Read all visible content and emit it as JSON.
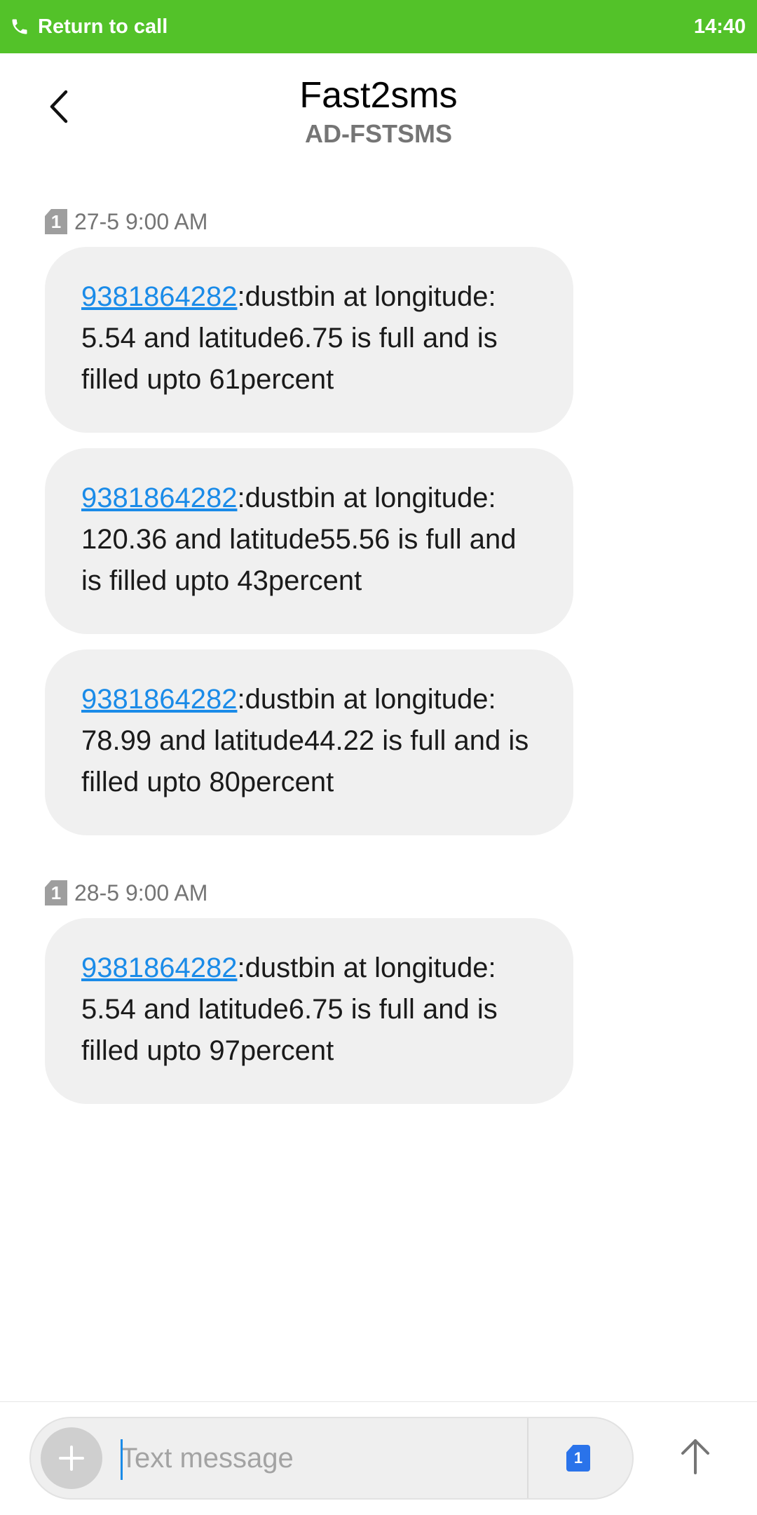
{
  "call_banner": {
    "label": "Return to call",
    "time": "14:40",
    "icon": "phone-icon",
    "color": "#53c229"
  },
  "header": {
    "back_icon": "chevron-left-icon",
    "contact_name": "Fast2sms",
    "sender_id": "AD-FSTSMS"
  },
  "thread": {
    "groups": [
      {
        "sim": "1",
        "timestamp": "27-5 9:00 AM",
        "messages": [
          {
            "link": "9381864282",
            "text": ":dustbin at longitude: 5.54 and latitude6.75 is full and is filled upto 61percent"
          },
          {
            "link": "9381864282",
            "text": ":dustbin at longitude: 120.36 and latitude55.56 is full and is filled upto 43percent"
          },
          {
            "link": "9381864282",
            "text": ":dustbin at longitude: 78.99 and latitude44.22 is full and is filled upto 80percent"
          }
        ]
      },
      {
        "sim": "1",
        "timestamp": "28-5 9:00 AM",
        "messages": [
          {
            "link": "9381864282",
            "text": ":dustbin at longitude: 5.54 and latitude6.75 is full and is filled upto 97percent"
          }
        ]
      }
    ]
  },
  "composer": {
    "placeholder": "Text message",
    "value": "",
    "add_icon": "plus-icon",
    "sim_label": "1",
    "send_icon": "arrow-up-icon",
    "sim_color": "#2a73ea",
    "link_color": "#1a8be8"
  }
}
